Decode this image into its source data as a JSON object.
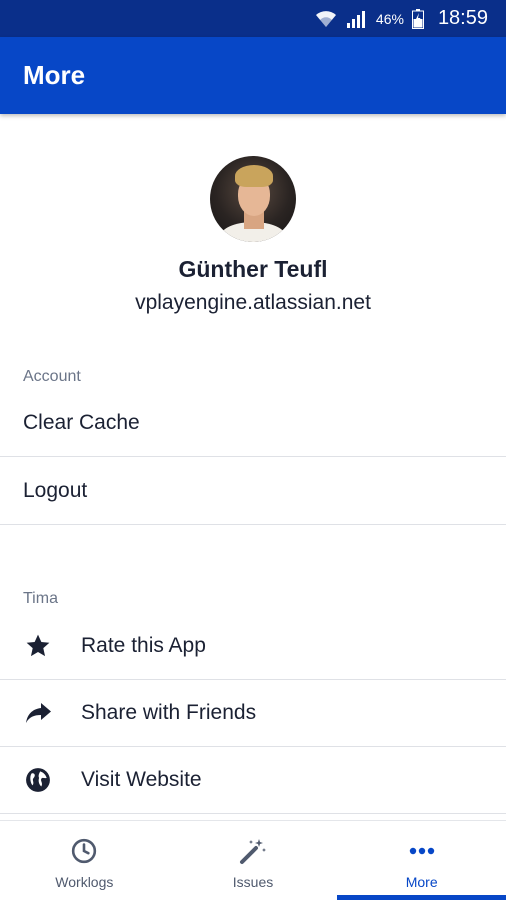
{
  "status_bar": {
    "battery_percent": "46%",
    "time": "18:59"
  },
  "app_bar": {
    "title": "More"
  },
  "profile": {
    "name": "Günther Teufl",
    "site": "vplayengine.atlassian.net"
  },
  "account_section": {
    "label": "Account",
    "items": [
      {
        "label": "Clear Cache"
      },
      {
        "label": "Logout"
      }
    ]
  },
  "tima_section": {
    "label": "Tima",
    "items": [
      {
        "label": "Rate this App",
        "icon": "star-icon"
      },
      {
        "label": "Share with Friends",
        "icon": "share-icon"
      },
      {
        "label": "Visit Website",
        "icon": "globe-icon"
      }
    ]
  },
  "bottom_nav": {
    "tabs": [
      {
        "label": "Worklogs",
        "icon": "clock-icon"
      },
      {
        "label": "Issues",
        "icon": "magic-wand-icon"
      },
      {
        "label": "More",
        "icon": "more-dots-icon"
      }
    ],
    "active_tab": "More"
  },
  "colors": {
    "status_bar": "#0a2f8a",
    "app_bar": "#0747c7",
    "text_primary": "#1b2133",
    "text_secondary": "#6b7588",
    "active_tab": "#0747c7"
  }
}
